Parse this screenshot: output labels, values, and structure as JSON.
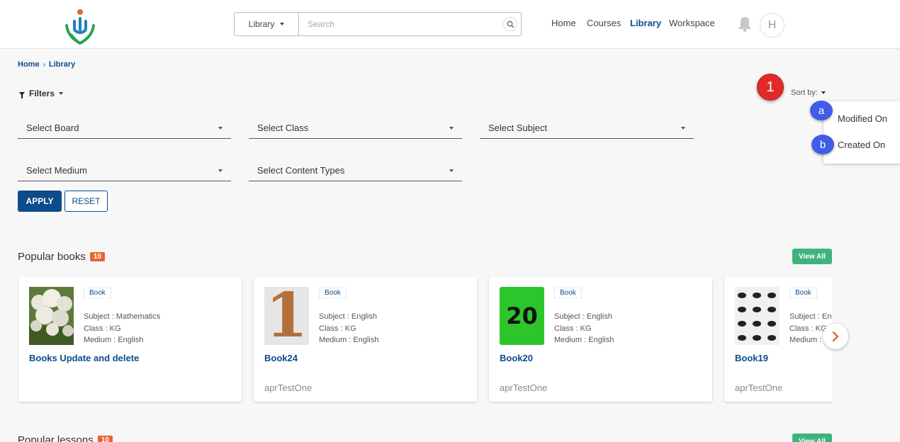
{
  "header": {
    "search": {
      "scope": "Library",
      "placeholder": "Search"
    },
    "nav": {
      "home": "Home",
      "courses": "Courses",
      "library": "Library",
      "workspace": "Workspace"
    },
    "avatar_initial": "H"
  },
  "breadcrumb": {
    "home": "Home",
    "current": "Library"
  },
  "filters": {
    "label": "Filters",
    "board": "Select Board",
    "class": "Select Class",
    "subject": "Select Subject",
    "medium": "Select Medium",
    "content_types": "Select Content Types",
    "apply": "APPLY",
    "reset": "RESET"
  },
  "sort": {
    "label": "Sort by:",
    "options": [
      "Modified On",
      "Created On"
    ]
  },
  "callouts": {
    "main": "1",
    "a": "a",
    "b": "b"
  },
  "popular_books": {
    "title": "Popular books",
    "count": "10",
    "view_all": "View All",
    "cards": [
      {
        "type": "Book",
        "subject": "Subject : Mathematics",
        "class": "Class : KG",
        "medium": "Medium : English",
        "title": "Books Update and delete",
        "org": ""
      },
      {
        "type": "Book",
        "subject": "Subject : English",
        "class": "Class : KG",
        "medium": "Medium : English",
        "title": "Book24",
        "org": "aprTestOne",
        "thumb_text": "1"
      },
      {
        "type": "Book",
        "subject": "Subject : English",
        "class": "Class : KG",
        "medium": "Medium : English",
        "title": "Book20",
        "org": "aprTestOne",
        "thumb_text": "20"
      },
      {
        "type": "Book",
        "subject": "Subject : English",
        "class": "Class : KG",
        "medium": "Medium : English",
        "title": "Book19",
        "org": "aprTestOne"
      }
    ]
  },
  "popular_lessons": {
    "title": "Popular lessons",
    "count": "10",
    "view_all": "View All"
  },
  "colors": {
    "brand": "#0c4c8c",
    "accent_green": "#3fb37f",
    "badge_orange": "#e9642d",
    "callout_red": "#e12b2b",
    "callout_blue": "#3f5de8"
  }
}
